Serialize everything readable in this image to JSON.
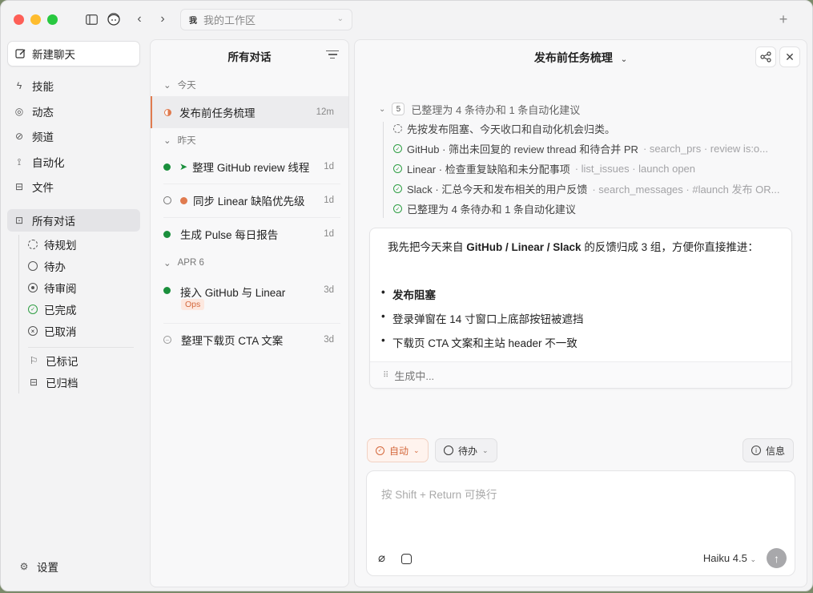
{
  "workspace": {
    "badge": "我",
    "name": "我的工作区"
  },
  "sidebar": {
    "new_chat": "新建聊天",
    "nav": [
      {
        "label": "技能",
        "icon": "lightning-icon"
      },
      {
        "label": "动态",
        "icon": "activity-icon"
      },
      {
        "label": "频道",
        "icon": "channel-icon"
      },
      {
        "label": "自动化",
        "icon": "automation-icon"
      },
      {
        "label": "文件",
        "icon": "file-icon"
      }
    ],
    "all_chats": "所有对话",
    "statuses": [
      "待规划",
      "待办",
      "待审阅",
      "已完成",
      "已取消"
    ],
    "extras": [
      "已标记",
      "已归档"
    ],
    "settings": "设置"
  },
  "convlist": {
    "title": "所有对话",
    "groups": [
      "今天",
      "昨天",
      "APR 6"
    ],
    "items": [
      {
        "title": "发布前任务梳理",
        "time": "12m"
      },
      {
        "title": "整理 GitHub review 线程",
        "time": "1d"
      },
      {
        "title": "同步 Linear 缺陷优先级",
        "time": "1d"
      },
      {
        "title": "生成 Pulse 每日报告",
        "time": "1d"
      },
      {
        "title": "接入 GitHub 与 Linear",
        "time": "3d",
        "tag": "Ops"
      },
      {
        "title": "整理下载页 CTA 文案",
        "time": "3d"
      }
    ]
  },
  "main": {
    "title": "发布前任务梳理",
    "steps": {
      "count": "5",
      "summary": "已整理为 4 条待办和 1 条自动化建议",
      "rows": [
        {
          "text": "先按发布阻塞、今天收口和自动化机会归类。",
          "meta": ""
        },
        {
          "text": "GitHub · 筛出未回复的 review thread 和待合并 PR",
          "meta": " · search_prs · review is:o..."
        },
        {
          "text": "Linear · 检查重复缺陷和未分配事项",
          "meta": " · list_issues · launch open"
        },
        {
          "text": "Slack · 汇总今天和发布相关的用户反馈",
          "meta": " · search_messages · #launch 发布 OR..."
        },
        {
          "text": "已整理为 4 条待办和 1 条自动化建议",
          "meta": ""
        }
      ]
    },
    "answer": {
      "intro_1": "我先把今天来自 ",
      "intro_bold": "GitHub / Linear / Slack",
      "intro_2": " 的反馈归成 3 组，方便你直接推进：",
      "group_title": "发布阻塞",
      "bullets": [
        "登录弹窗在 14 寸窗口上底部按钮被遮挡",
        "下载页 CTA 文案和主站 header 不一致"
      ],
      "status": "生成中..."
    },
    "chips": {
      "auto": "自动",
      "todo": "待办",
      "info": "信息"
    },
    "composer": {
      "placeholder": "按 Shift + Return 可换行",
      "model": "Haiku 4.5"
    }
  }
}
